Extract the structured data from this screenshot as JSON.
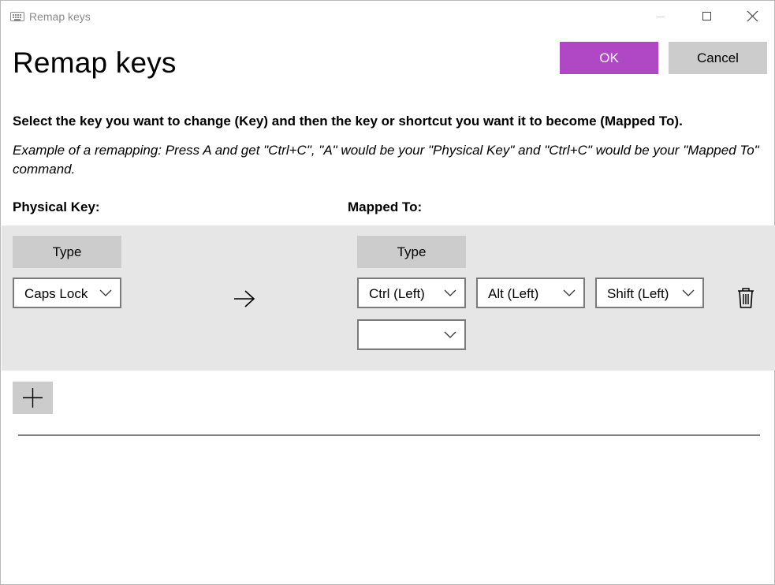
{
  "window": {
    "title": "Remap keys"
  },
  "header": {
    "page_title": "Remap keys",
    "ok_label": "OK",
    "cancel_label": "Cancel"
  },
  "instructions": "Select the key you want to change (Key) and then the key or shortcut you want it to become (Mapped To).",
  "example": "Example of a remapping: Press A and get \"Ctrl+C\", \"A\" would be your \"Physical Key\" and \"Ctrl+C\" would be your \"Mapped To\" command.",
  "columns": {
    "physical_label": "Physical Key:",
    "mapped_label": "Mapped To:"
  },
  "remap_row": {
    "physical_type_label": "Type",
    "physical_key": "Caps Lock",
    "mapped_type_label": "Type",
    "mapped_keys": [
      "Ctrl (Left)",
      "Alt (Left)",
      "Shift (Left)",
      ""
    ]
  },
  "colors": {
    "accent": "#b048c5",
    "button_gray": "#cccccc",
    "row_background": "#e6e6e6"
  },
  "icons": {
    "app": "keyboard-icon",
    "minimize": "minimize-icon",
    "maximize": "maximize-icon",
    "close": "close-icon",
    "arrow": "arrow-right-icon",
    "delete": "trash-icon",
    "add": "plus-icon",
    "dropdown": "chevron-down-icon"
  }
}
